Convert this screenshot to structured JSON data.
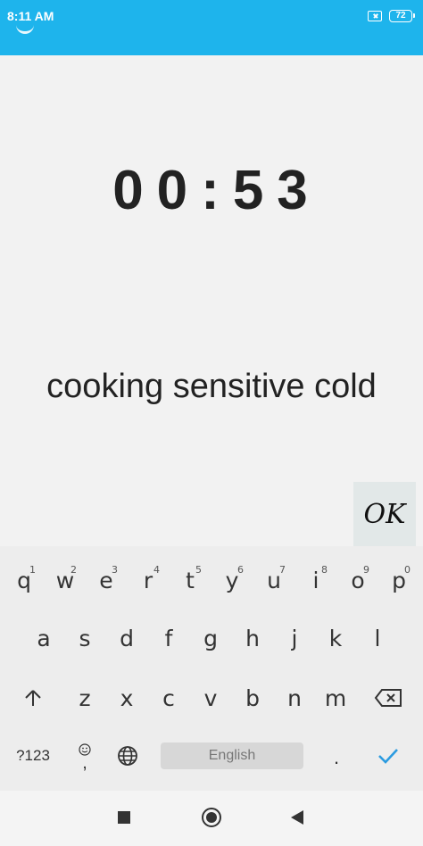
{
  "status_bar": {
    "time": "8:11 AM",
    "battery": "72",
    "color": "#1eb4ec"
  },
  "timer": "00:53",
  "phrase": "cooking sensitive cold",
  "ok_button": {
    "label": "OK"
  },
  "keyboard": {
    "row1": [
      {
        "letter": "q",
        "hint": "1"
      },
      {
        "letter": "w",
        "hint": "2"
      },
      {
        "letter": "e",
        "hint": "3"
      },
      {
        "letter": "r",
        "hint": "4"
      },
      {
        "letter": "t",
        "hint": "5"
      },
      {
        "letter": "y",
        "hint": "6"
      },
      {
        "letter": "u",
        "hint": "7"
      },
      {
        "letter": "i",
        "hint": "8"
      },
      {
        "letter": "o",
        "hint": "9"
      },
      {
        "letter": "p",
        "hint": "0"
      }
    ],
    "row2": [
      "a",
      "s",
      "d",
      "f",
      "g",
      "h",
      "j",
      "k",
      "l"
    ],
    "row3": [
      "z",
      "x",
      "c",
      "v",
      "b",
      "n",
      "m"
    ],
    "symbols_label": "?123",
    "comma_label": ",",
    "space_label": "English",
    "period_label": ".",
    "icons": {
      "shift": "shift-arrow-icon",
      "backspace": "backspace-icon",
      "emoji": "emoji-icon",
      "language": "globe-icon",
      "enter": "checkmark-icon"
    },
    "accent": "#2b9be0"
  }
}
